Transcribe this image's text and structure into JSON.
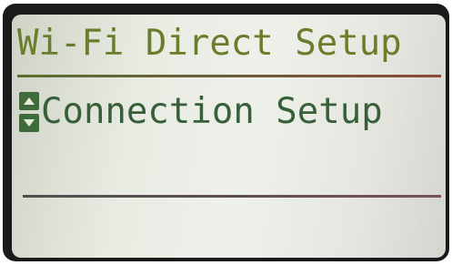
{
  "screen": {
    "title": "Wi-Fi Direct Setup"
  },
  "menu": {
    "selected_item": "Connection Setup",
    "scroll_icons": [
      "up-arrow-icon",
      "down-arrow-icon"
    ]
  },
  "colors": {
    "title_text": "#6b7d2a",
    "item_text": "#37603a",
    "lcd_background": "#e9ece3"
  }
}
